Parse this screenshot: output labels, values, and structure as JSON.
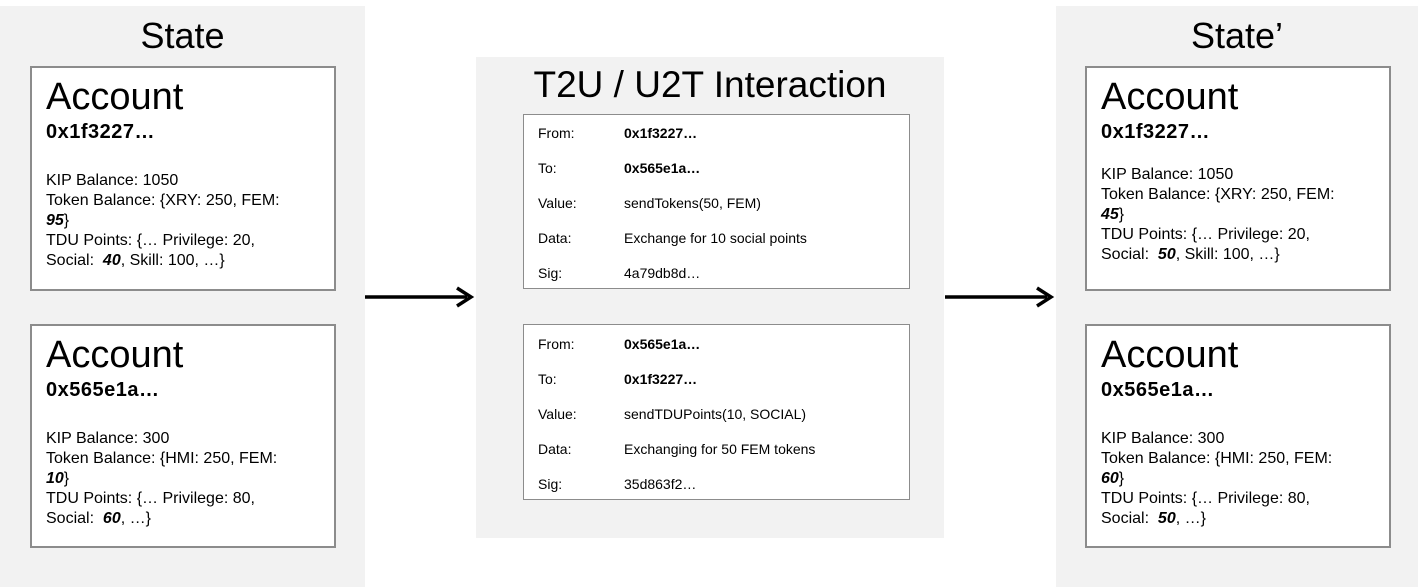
{
  "state": {
    "title": "State",
    "accounts": [
      {
        "title": "Account",
        "address": "0x1f3227…",
        "kip_balance": "KIP Balance: 1050",
        "token_prefix": "Token Balance:  {XRY: 250, FEM:",
        "token_value": "95",
        "token_suffix": "}",
        "tdu_line1": "TDU Points: {… Privilege: 20,",
        "tdu_prefix": "Social:  ",
        "tdu_value": "40",
        "tdu_suffix": ", Skill: 100, …}"
      },
      {
        "title": "Account",
        "address": "0x565e1a…",
        "kip_balance": "KIP Balance: 300",
        "token_prefix": "Token Balance:  {HMI: 250, FEM:",
        "token_value": "10",
        "token_suffix": "}",
        "tdu_line1": "TDU Points: {… Privilege: 80,",
        "tdu_prefix": "Social:  ",
        "tdu_value": "60",
        "tdu_suffix": ", …}"
      }
    ]
  },
  "interaction": {
    "title": "T2U / U2T Interaction",
    "transactions": [
      {
        "rows": [
          {
            "key": "From:",
            "value": "0x1f3227…",
            "bold": true
          },
          {
            "key": "To:",
            "value": "0x565e1a…",
            "bold": true
          },
          {
            "key": "Value:",
            "value": "sendTokens(50, FEM)",
            "bold": false
          },
          {
            "key": "Data:",
            "value": "Exchange for 10 social points",
            "bold": false
          },
          {
            "key": "Sig:",
            "value": "4a79db8d…",
            "bold": false
          }
        ]
      },
      {
        "rows": [
          {
            "key": "From:",
            "value": "0x565e1a…",
            "bold": true
          },
          {
            "key": "To:",
            "value": "0x1f3227…",
            "bold": true
          },
          {
            "key": "Value:",
            "value": "sendTDUPoints(10, SOCIAL)",
            "bold": false
          },
          {
            "key": "Data:",
            "value": "Exchanging for 50 FEM tokens",
            "bold": false
          },
          {
            "key": "Sig:",
            "value": "35d863f2…",
            "bold": false
          }
        ]
      }
    ]
  },
  "state_prime": {
    "title": "State’",
    "accounts": [
      {
        "title": "Account",
        "address": "0x1f3227…",
        "kip_balance": "KIP Balance: 1050",
        "token_prefix": "Token Balance:  {XRY: 250, FEM:",
        "token_value": "45",
        "token_suffix": "}",
        "tdu_line1": "TDU Points: {… Privilege: 20,",
        "tdu_prefix": "Social:  ",
        "tdu_value": "50",
        "tdu_suffix": ", Skill: 100, …}"
      },
      {
        "title": "Account",
        "address": "0x565e1a…",
        "kip_balance": "KIP Balance: 300",
        "token_prefix": "Token Balance:  {HMI: 250, FEM:",
        "token_value": "60",
        "token_suffix": "}",
        "tdu_line1": "TDU Points: {… Privilege: 80,",
        "tdu_prefix": "Social:  ",
        "tdu_value": "50",
        "tdu_suffix": ", …}"
      }
    ]
  }
}
